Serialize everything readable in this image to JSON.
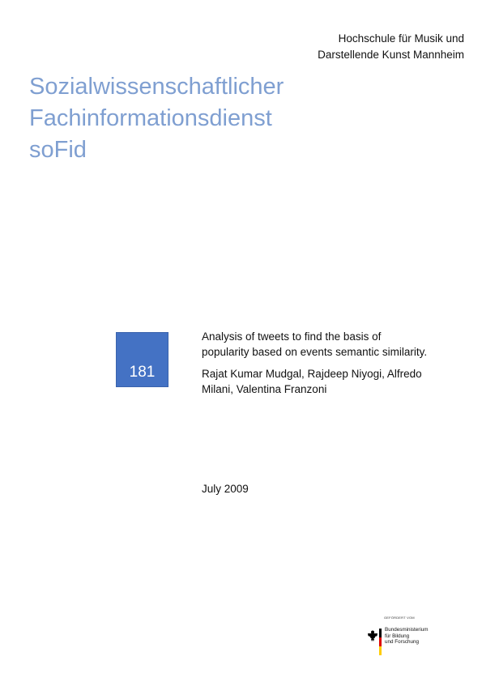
{
  "institution": {
    "line1": "Hochschule für Musik und",
    "line2": "Darstellende Kunst Mannheim"
  },
  "main_title": {
    "line1": "Sozialwissenschaftlicher",
    "line2": "Fachinformationsdienst",
    "line3": "soFid"
  },
  "issue_number": "181",
  "report": {
    "title_line1": "Analysis of tweets to find the basis of",
    "title_line2": "popularity based on events semantic similarity.",
    "authors_line1": "Rajat Kumar Mudgal, Rajdeep Niyogi, Alfredo",
    "authors_line2": "Milani, Valentina Franzoni"
  },
  "date": "July 2009",
  "funder": {
    "label": "GEFÖRDERT VOM",
    "line1": "Bundesministerium",
    "line2": "für Bildung",
    "line3": "und Forschung"
  },
  "colors": {
    "title": "#7f9fd1",
    "box": "#4472c4",
    "flag_black": "#000000",
    "flag_red": "#dd0000",
    "flag_gold": "#ffcc00"
  },
  "icons": {
    "funder_logo": "eagle-flag-icon"
  }
}
